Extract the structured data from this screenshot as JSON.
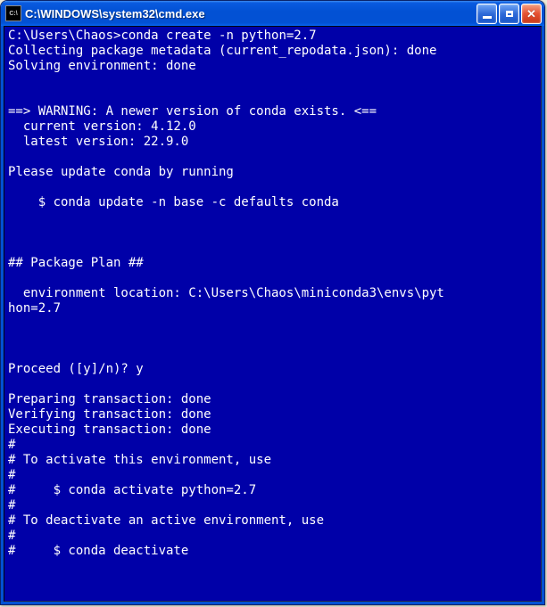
{
  "titlebar": {
    "icon_label": "C:\\",
    "title": "C:\\WINDOWS\\system32\\cmd.exe"
  },
  "terminal": {
    "prompt": "C:\\Users\\Chaos>",
    "command": "conda create -n python=2.7",
    "lines": [
      "Collecting package metadata (current_repodata.json): done",
      "Solving environment: done",
      "",
      "",
      "==> WARNING: A newer version of conda exists. <==",
      "  current version: 4.12.0",
      "  latest version: 22.9.0",
      "",
      "Please update conda by running",
      "",
      "    $ conda update -n base -c defaults conda",
      "",
      "",
      "",
      "## Package Plan ##",
      "",
      "  environment location: C:\\Users\\Chaos\\miniconda3\\envs\\pyt",
      "hon=2.7",
      "",
      "",
      "",
      "Proceed ([y]/n)? y",
      "",
      "Preparing transaction: done",
      "Verifying transaction: done",
      "Executing transaction: done",
      "#",
      "# To activate this environment, use",
      "#",
      "#     $ conda activate python=2.7",
      "#",
      "# To deactivate an active environment, use",
      "#",
      "#     $ conda deactivate"
    ]
  }
}
